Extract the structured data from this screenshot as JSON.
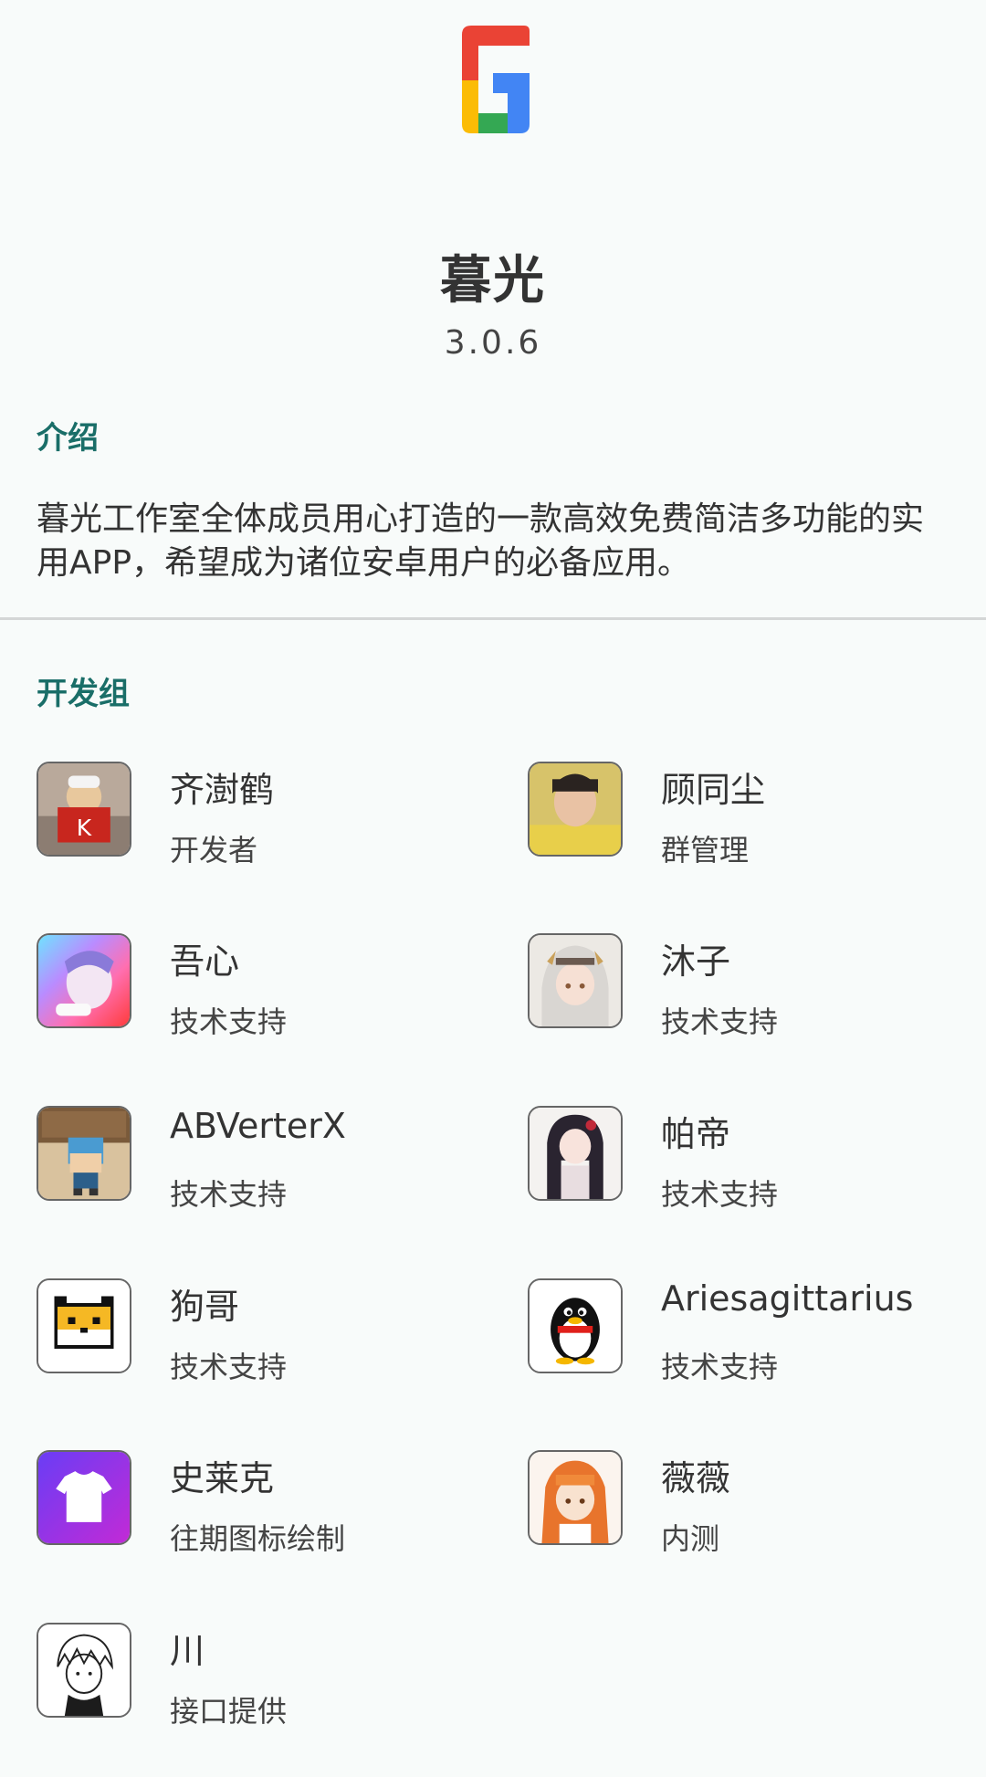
{
  "app": {
    "name": "暮光",
    "version": "3.0.6"
  },
  "intro": {
    "title": "介绍",
    "text": "暮光工作室全体成员用心打造的一款高效免费简洁多功能的实用APP，希望成为诸位安卓用户的必备应用。"
  },
  "team": {
    "title": "开发组",
    "members": [
      {
        "name": "齐澍鹤",
        "role": "开发者",
        "avatar_icon": "cat-avatar-icon"
      },
      {
        "name": "顾同尘",
        "role": "群管理",
        "avatar_icon": "person-photo-avatar-icon"
      },
      {
        "name": "吾心",
        "role": "技术支持",
        "avatar_icon": "anime-rainbow-avatar-icon"
      },
      {
        "name": "沐子",
        "role": "技术支持",
        "avatar_icon": "anime-girl-avatar-icon"
      },
      {
        "name": "ABVerterX",
        "role": "技术支持",
        "avatar_icon": "blocky-character-avatar-icon"
      },
      {
        "name": "帕帝",
        "role": "技术支持",
        "avatar_icon": "anime-dark-hair-avatar-icon"
      },
      {
        "name": "狗哥",
        "role": "技术支持",
        "avatar_icon": "pixel-dog-avatar-icon"
      },
      {
        "name": "Ariesagittarius",
        "role": "技术支持",
        "avatar_icon": "penguin-avatar-icon"
      },
      {
        "name": "史莱克",
        "role": "往期图标绘制",
        "avatar_icon": "theme-shirt-avatar-icon"
      },
      {
        "name": "薇薇",
        "role": "内测",
        "avatar_icon": "anime-orange-girl-avatar-icon"
      },
      {
        "name": "川",
        "role": "接口提供",
        "avatar_icon": "sketch-boy-avatar-icon"
      }
    ]
  },
  "colors": {
    "accent": "#1a6e68",
    "background": "#f8fbfa",
    "logo_red": "#ea4335",
    "logo_yellow": "#fbbc05",
    "logo_green": "#34a853",
    "logo_blue": "#4285f4"
  }
}
